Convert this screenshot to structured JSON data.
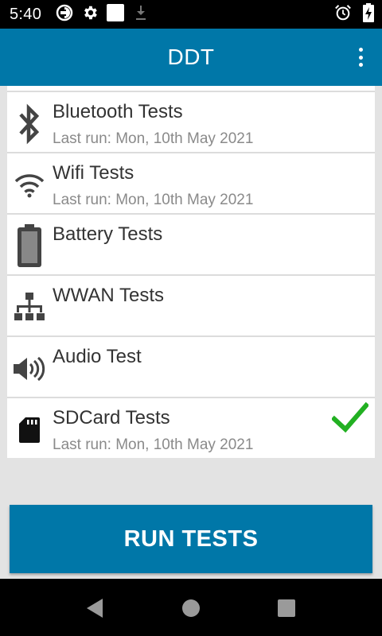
{
  "status_bar": {
    "time": "5:40",
    "left_icons": [
      "data-saver-icon",
      "settings-gear-icon",
      "square-notification-icon",
      "download-icon"
    ],
    "right_icons": [
      "alarm-clock-icon",
      "battery-charging-icon"
    ]
  },
  "app_bar": {
    "title": "DDT",
    "menu_icon": "overflow-menu-icon",
    "color": "#0077a8"
  },
  "tests": [
    {
      "icon": "bluetooth-icon",
      "title": "Bluetooth Tests",
      "subtitle": "Last run: Mon, 10th May 2021",
      "passed": false
    },
    {
      "icon": "wifi-icon",
      "title": "Wifi Tests",
      "subtitle": "Last run: Mon, 10th May 2021",
      "passed": false
    },
    {
      "icon": "battery-icon",
      "title": "Battery Tests",
      "subtitle": "",
      "passed": false
    },
    {
      "icon": "network-icon",
      "title": "WWAN Tests",
      "subtitle": "",
      "passed": false
    },
    {
      "icon": "speaker-icon",
      "title": "Audio Test",
      "subtitle": "",
      "passed": false
    },
    {
      "icon": "sdcard-icon",
      "title": "SDCard Tests",
      "subtitle": "Last run: Mon, 10th May 2021",
      "passed": true
    }
  ],
  "run_button": {
    "label": "RUN TESTS"
  },
  "nav_bar": {
    "buttons": [
      "back-icon",
      "home-icon",
      "recents-icon"
    ]
  },
  "colors": {
    "check": "#22b022",
    "accent": "#0077a8"
  }
}
